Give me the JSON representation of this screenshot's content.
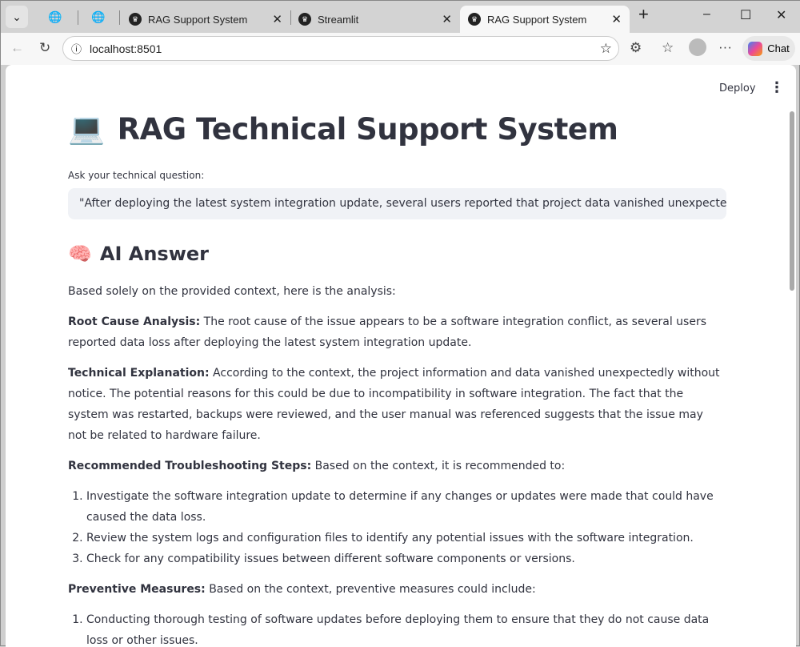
{
  "browser": {
    "tabs": [
      {
        "title": "RAG Support System"
      },
      {
        "title": "Streamlit"
      },
      {
        "title": "RAG Support System"
      }
    ],
    "url": "localhost:8501",
    "chat_label": "Chat"
  },
  "header": {
    "deploy": "Deploy"
  },
  "main": {
    "title_icon": "💻",
    "title": "RAG Technical Support System",
    "question_label": "Ask your technical question:",
    "question_value": "\"After deploying the latest system integration update, several users reported that project data vanished unexpectedly. The",
    "answer_icon": "🧠",
    "answer_heading": "AI Answer",
    "intro": "Based solely on the provided context, here is the analysis:",
    "root_label": "Root Cause Analysis:",
    "root_text": " The root cause of the issue appears to be a software integration conflict, as several users reported data loss after deploying the latest system integration update.",
    "tech_label": "Technical Explanation:",
    "tech_text": " According to the context, the project information and data vanished unexpectedly without notice. The potential reasons for this could be due to incompatibility in software integration. The fact that the system was restarted, backups were reviewed, and the user manual was referenced suggests that the issue may not be related to hardware failure.",
    "steps_label": "Recommended Troubleshooting Steps:",
    "steps_text": " Based on the context, it is recommended to:",
    "steps": [
      "Investigate the software integration update to determine if any changes or updates were made that could have caused the data loss.",
      "Review the system logs and configuration files to identify any potential issues with the software integration.",
      "Check for any compatibility issues between different software components or versions."
    ],
    "prev_label": "Preventive Measures:",
    "prev_text": " Based on the context, preventive measures could include:",
    "prev": [
      "Conducting thorough testing of software updates before deploying them to ensure that they do not cause data loss or other issues."
    ]
  }
}
